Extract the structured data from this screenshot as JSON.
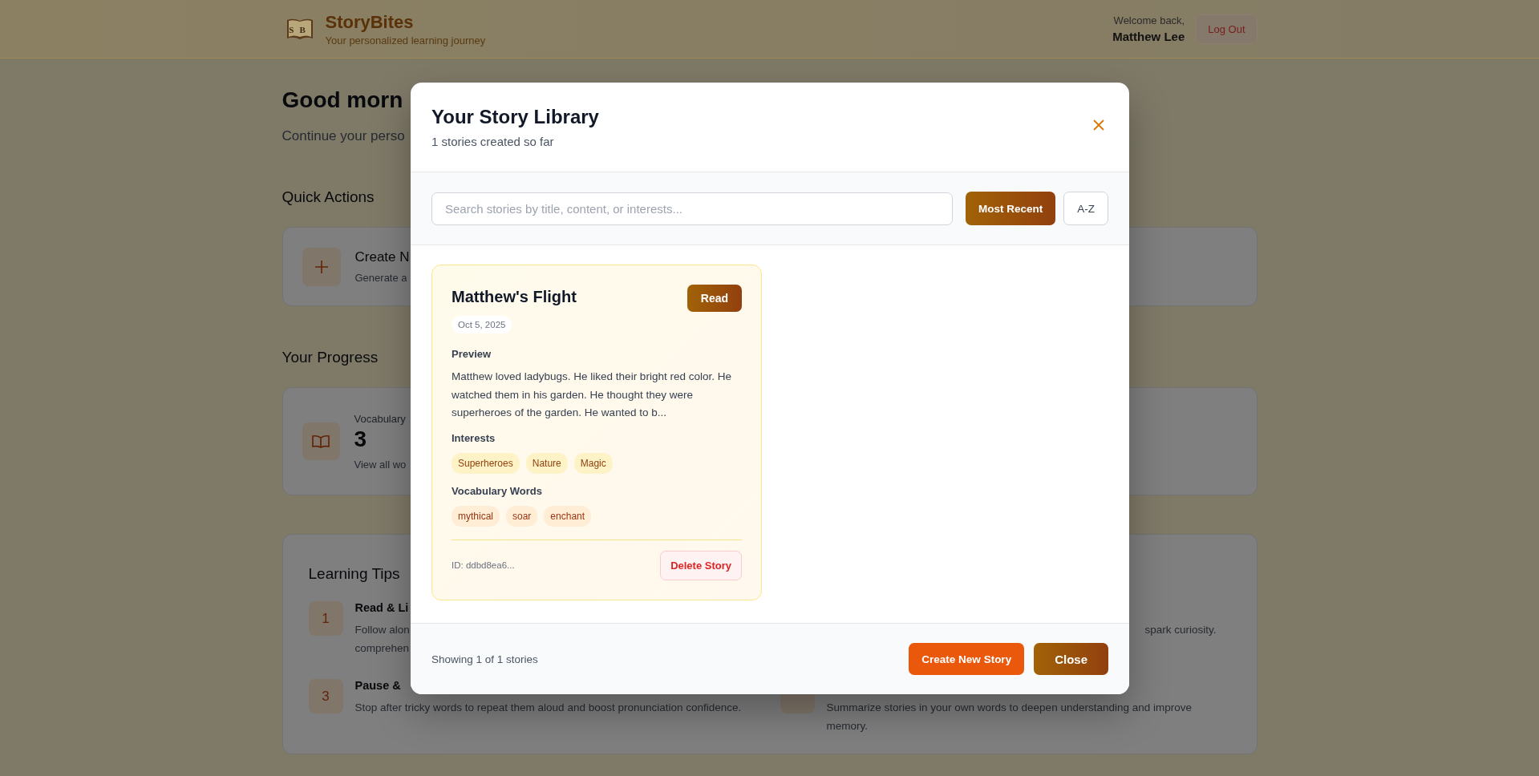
{
  "header": {
    "logo_letters": "SB",
    "brand": "StoryBites",
    "tagline": "Your personalized learning journey",
    "welcome": "Welcome back,",
    "user": "Matthew Lee",
    "logout": "Log Out"
  },
  "page": {
    "greeting": "Good morn",
    "subtitle": "Continue your perso",
    "quick_actions": {
      "heading": "Quick Actions",
      "items": [
        {
          "title": "Create N",
          "description": "Generate a"
        }
      ]
    },
    "progress": {
      "heading": "Your Progress",
      "items": [
        {
          "label": "Vocabulary",
          "value": "3",
          "link": "View all wo"
        }
      ]
    },
    "tips": {
      "heading": "Learning Tips",
      "items": [
        {
          "number": "1",
          "title": "Read & Li",
          "lines": [
            "Follow alon",
            "comprehen"
          ]
        },
        {
          "lines": [
            "spark curiosity."
          ]
        },
        {
          "number": "3",
          "title": "Pause &",
          "lines": [
            "Stop after tricky words to repeat them aloud and boost pronunciation confidence."
          ]
        },
        {
          "badge": true,
          "lines": [
            "Summarize stories in your own words to deepen understanding and improve",
            "memory."
          ]
        }
      ]
    }
  },
  "modal": {
    "title": "Your Story Library",
    "subtitle": "1 stories created so far",
    "search": {
      "placeholder": "Search stories by title, content, or interests..."
    },
    "sort_options": [
      {
        "label": "Most Recent",
        "selected": true
      },
      {
        "label": "A-Z",
        "selected": false
      }
    ],
    "stories": [
      {
        "title": "Matthew's Flight",
        "read": "Read",
        "date": "Oct 5, 2025",
        "preview_heading": "Preview",
        "preview": "Matthew loved ladybugs. He liked their bright red color. He watched them in his garden. He thought they were superheroes of the garden. He wanted to b...",
        "interests_heading": "Interests",
        "interests": [
          "Superheroes",
          "Nature",
          "Magic"
        ],
        "vocab_heading": "Vocabulary Words",
        "vocab": [
          "mythical",
          "soar",
          "enchant"
        ],
        "id": "ID: ddbd8ea6...",
        "delete": "Delete Story"
      }
    ],
    "footer": {
      "count": "Showing 1 of 1 stories",
      "create": "Create New Story",
      "close": "Close"
    }
  }
}
